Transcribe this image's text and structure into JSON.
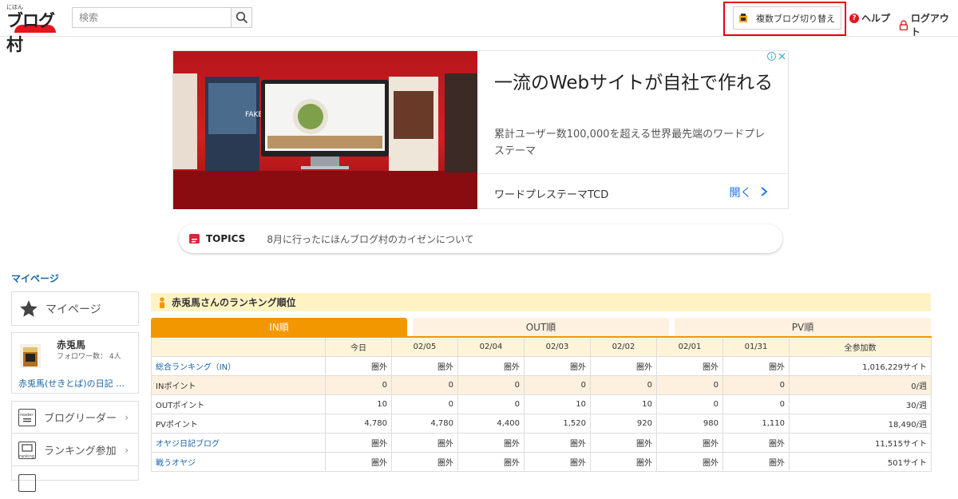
{
  "header": {
    "logo_small": "にほん",
    "logo_main": "ブログ村",
    "search_placeholder": "検索",
    "switch_label": "複数ブログ切り替え",
    "help_label": "ヘルプ",
    "logout_label": "ログアウト"
  },
  "ad": {
    "title": "一流のWebサイトが自社で作れる",
    "desc": "累計ユーザー数100,000を超える世界最先端のワードプレステーマ",
    "brand": "ワードプレステーマTCD",
    "open_label": "開く",
    "screen_caption": "FAKE"
  },
  "topics": {
    "label": "TOPICS",
    "text": "8月に行ったにほんブログ村のカイゼンについて"
  },
  "mypage_title": "マイページ",
  "sidebar": {
    "mypage_label": "マイページ",
    "user": {
      "name": "赤兎馬",
      "followers": "フォロワー数：",
      "followers_count": "4人",
      "blog": "赤兎馬(せきとば)の日記 …"
    },
    "menu": [
      {
        "label": "ブログリーダー",
        "icon_text": "reader"
      },
      {
        "label": "ランキング参加",
        "icon_text": "ranking"
      }
    ]
  },
  "ranking": {
    "title": "赤兎馬さんのランキング順位",
    "tabs": [
      "IN順",
      "OUT順",
      "PV順"
    ],
    "columns": [
      "",
      "今日",
      "02/05",
      "02/04",
      "02/03",
      "02/02",
      "02/01",
      "01/31",
      "全参加数"
    ],
    "rows": [
      {
        "label": "総合ランキング（IN）",
        "link": true,
        "alt": false,
        "cells": [
          "圏外",
          "圏外",
          "圏外",
          "圏外",
          "圏外",
          "圏外",
          "圏外",
          "1,016,229サイト"
        ]
      },
      {
        "label": "INポイント",
        "link": false,
        "alt": true,
        "cells": [
          "0",
          "0",
          "0",
          "0",
          "0",
          "0",
          "0",
          "0/週"
        ]
      },
      {
        "label": "OUTポイント",
        "link": false,
        "alt": false,
        "cells": [
          "10",
          "0",
          "0",
          "10",
          "10",
          "0",
          "0",
          "30/週"
        ]
      },
      {
        "label": "PVポイント",
        "link": false,
        "alt": false,
        "cells": [
          "4,780",
          "4,780",
          "4,400",
          "1,520",
          "920",
          "980",
          "1,110",
          "18,490/週"
        ]
      },
      {
        "label": "オヤジ日記ブログ",
        "link": true,
        "alt": false,
        "cells": [
          "圏外",
          "圏外",
          "圏外",
          "圏外",
          "圏外",
          "圏外",
          "圏外",
          "11,515サイト"
        ]
      },
      {
        "label": "戦うオヤジ",
        "link": true,
        "alt": false,
        "cells": [
          "圏外",
          "圏外",
          "圏外",
          "圏外",
          "圏外",
          "圏外",
          "圏外",
          "501サイト"
        ]
      }
    ]
  },
  "colors": {
    "accent_orange": "#f39700",
    "header_yellow": "#fff3c4",
    "link_blue": "#1a63a8",
    "highlight_red": "#e60012"
  }
}
